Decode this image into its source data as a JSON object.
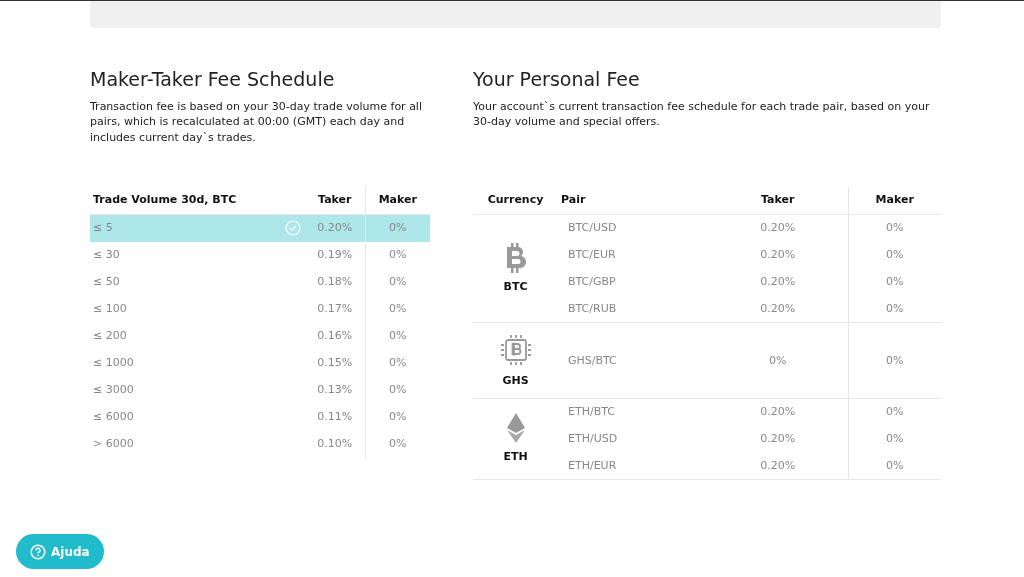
{
  "left": {
    "title": "Maker-Taker Fee Schedule",
    "description": "Transaction fee is based on your 30-day trade volume for all pairs, which is recalculated at 00:00 (GMT) each day and includes current day`s trades.",
    "columns": [
      "Trade Volume 30d, BTC",
      "Taker",
      "Maker"
    ],
    "rows": [
      {
        "volume": "≤ 5",
        "taker": "0.20%",
        "maker": "0%",
        "selected": true
      },
      {
        "volume": "≤ 30",
        "taker": "0.19%",
        "maker": "0%",
        "selected": false
      },
      {
        "volume": "≤ 50",
        "taker": "0.18%",
        "maker": "0%",
        "selected": false
      },
      {
        "volume": "≤ 100",
        "taker": "0.17%",
        "maker": "0%",
        "selected": false
      },
      {
        "volume": "≤ 200",
        "taker": "0.16%",
        "maker": "0%",
        "selected": false
      },
      {
        "volume": "≤ 1000",
        "taker": "0.15%",
        "maker": "0%",
        "selected": false
      },
      {
        "volume": "≤ 3000",
        "taker": "0.13%",
        "maker": "0%",
        "selected": false
      },
      {
        "volume": "≤ 6000",
        "taker": "0.11%",
        "maker": "0%",
        "selected": false
      },
      {
        "volume": "> 6000",
        "taker": "0.10%",
        "maker": "0%",
        "selected": false
      }
    ]
  },
  "right": {
    "title": "Your Personal Fee",
    "description": "Your account`s current transaction fee schedule for each trade pair, based on your 30-day volume and special offers.",
    "columns": [
      "Currency",
      "Pair",
      "Taker",
      "Maker"
    ],
    "groups": [
      {
        "currency": "BTC",
        "kind": "coin",
        "pairs": [
          {
            "pair": "BTC/USD",
            "taker": "0.20%",
            "maker": "0%"
          },
          {
            "pair": "BTC/EUR",
            "taker": "0.20%",
            "maker": "0%"
          },
          {
            "pair": "BTC/GBP",
            "taker": "0.20%",
            "maker": "0%"
          },
          {
            "pair": "BTC/RUB",
            "taker": "0.20%",
            "maker": "0%"
          }
        ]
      },
      {
        "currency": "GHS",
        "kind": "chip",
        "pairs": [
          {
            "pair": "GHS/BTC",
            "taker": "0%",
            "maker": "0%"
          }
        ]
      },
      {
        "currency": "ETH",
        "kind": "diamond",
        "pairs": [
          {
            "pair": "ETH/BTC",
            "taker": "0.20%",
            "maker": "0%"
          },
          {
            "pair": "ETH/USD",
            "taker": "0.20%",
            "maker": "0%"
          },
          {
            "pair": "ETH/EUR",
            "taker": "0.20%",
            "maker": "0%"
          }
        ]
      }
    ]
  },
  "help_button": {
    "label": "Ajuda"
  }
}
